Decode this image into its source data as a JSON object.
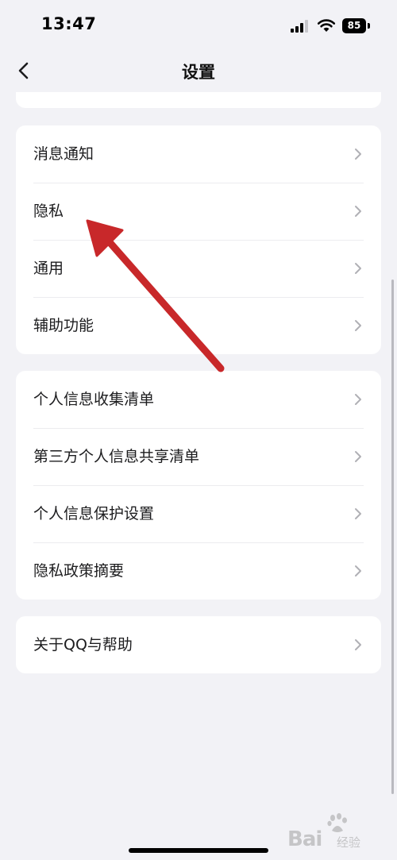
{
  "status_bar": {
    "time": "13:47",
    "battery": "85"
  },
  "nav": {
    "title": "设置",
    "back_icon": "chevron-left-icon"
  },
  "groups": [
    {
      "items": [
        {
          "label": "消息通知"
        },
        {
          "label": "隐私"
        },
        {
          "label": "通用"
        },
        {
          "label": "辅助功能"
        }
      ]
    },
    {
      "items": [
        {
          "label": "个人信息收集清单"
        },
        {
          "label": "第三方个人信息共享清单"
        },
        {
          "label": "个人信息保护设置"
        },
        {
          "label": "隐私政策摘要"
        }
      ]
    },
    {
      "items": [
        {
          "label": "关于QQ与帮助"
        }
      ]
    }
  ],
  "watermark": {
    "brand": "Bai",
    "sub": "经验"
  },
  "colors": {
    "background": "#f2f2f6",
    "card": "#ffffff",
    "annotation_arrow": "#c8282a",
    "chevron": "#b0b0b5"
  }
}
